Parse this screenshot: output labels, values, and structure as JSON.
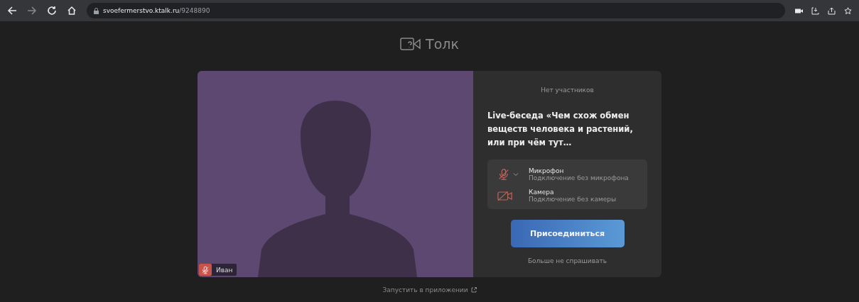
{
  "browser": {
    "url_host": "svoefermerstvo.ktalk.ru",
    "url_path": "/9248890"
  },
  "brand": {
    "name": "Толк"
  },
  "preview": {
    "participant": {
      "name": "Иван",
      "muted": true
    }
  },
  "panel": {
    "status": "Нет участников",
    "title": "Live-беседа «Чем схож обмен веществ человека и растений, или при чём тут…",
    "devices": [
      {
        "kind": "microphone",
        "name": "Микрофон",
        "detail": "Подключение без микрофона",
        "disabled": true
      },
      {
        "kind": "camera",
        "name": "Камера",
        "detail": "Подключение без камеры",
        "disabled": true
      }
    ],
    "join_button": "Присоединиться",
    "dont_ask_link": "Больше не спрашивать"
  },
  "footer_link": "Запустить в приложении"
}
